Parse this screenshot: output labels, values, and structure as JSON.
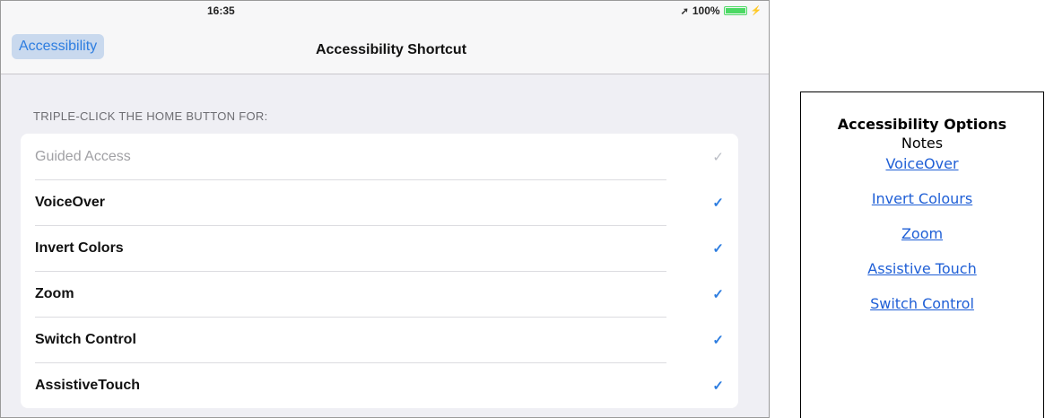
{
  "statusbar": {
    "time": "16:35",
    "location_icon": "location-arrow-icon",
    "battery_percent": "100%",
    "battery_level": 1.0
  },
  "navbar": {
    "back_label": "Accessibility",
    "title": "Accessibility Shortcut"
  },
  "section_header": "TRIPLE-CLICK THE HOME BUTTON FOR:",
  "options": [
    {
      "label": "Guided Access",
      "checked": true,
      "disabled": true
    },
    {
      "label": "VoiceOver",
      "checked": true,
      "disabled": false
    },
    {
      "label": "Invert Colors",
      "checked": true,
      "disabled": false
    },
    {
      "label": "Zoom",
      "checked": true,
      "disabled": false
    },
    {
      "label": "Switch Control",
      "checked": true,
      "disabled": false
    },
    {
      "label": "AssistiveTouch",
      "checked": true,
      "disabled": false
    }
  ],
  "notes": {
    "title": "Accessibility Options",
    "subtitle": "Notes",
    "links": [
      "VoiceOver",
      "Invert Colours",
      "Zoom",
      "Assistive Touch",
      "Switch Control"
    ]
  },
  "colors": {
    "accent": "#2d7de0",
    "battery": "#4cd964",
    "link": "#1f5fd6"
  }
}
